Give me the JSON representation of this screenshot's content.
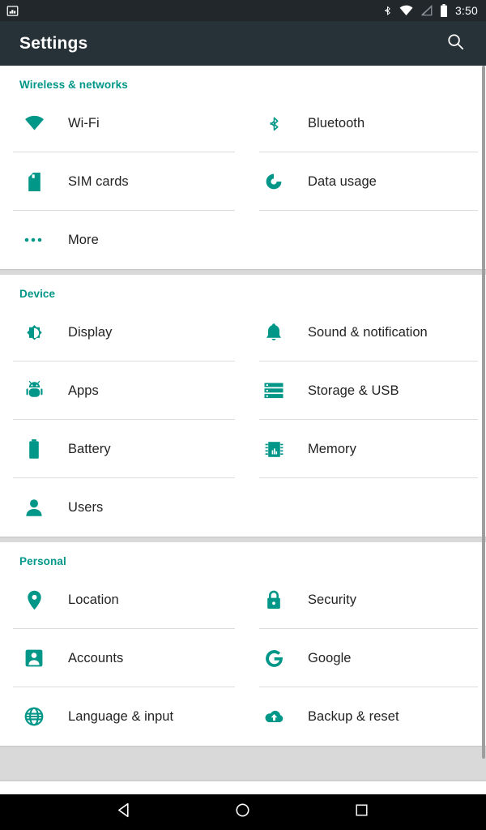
{
  "status_bar": {
    "notification_icon": "image-notification-icon",
    "icons": [
      "bluetooth-icon",
      "wifi-icon",
      "no-sim-signal-icon",
      "battery-icon"
    ],
    "clock": "3:50",
    "background_color": "#21272b"
  },
  "app_bar": {
    "title": "Settings",
    "search_icon": "search-icon",
    "background_color": "#263238"
  },
  "accent_color": "#009688",
  "sections": [
    {
      "title": "Wireless & networks",
      "items": [
        {
          "label": "Wi-Fi",
          "icon": "wifi-icon"
        },
        {
          "label": "Bluetooth",
          "icon": "bluetooth-icon"
        },
        {
          "label": "SIM cards",
          "icon": "sim-card-icon"
        },
        {
          "label": "Data usage",
          "icon": "data-usage-icon"
        },
        {
          "label": "More",
          "icon": "more-dots-icon"
        }
      ]
    },
    {
      "title": "Device",
      "items": [
        {
          "label": "Display",
          "icon": "brightness-icon"
        },
        {
          "label": "Sound & notification",
          "icon": "bell-icon"
        },
        {
          "label": "Apps",
          "icon": "android-robot-icon"
        },
        {
          "label": "Storage & USB",
          "icon": "storage-icon"
        },
        {
          "label": "Battery",
          "icon": "battery-icon"
        },
        {
          "label": "Memory",
          "icon": "memory-chip-icon"
        },
        {
          "label": "Users",
          "icon": "person-icon"
        }
      ]
    },
    {
      "title": "Personal",
      "items": [
        {
          "label": "Location",
          "icon": "location-pin-icon"
        },
        {
          "label": "Security",
          "icon": "lock-icon"
        },
        {
          "label": "Accounts",
          "icon": "account-box-icon"
        },
        {
          "label": "Google",
          "icon": "google-g-icon"
        },
        {
          "label": "Language & input",
          "icon": "globe-icon"
        },
        {
          "label": "Backup & reset",
          "icon": "cloud-upload-icon"
        }
      ]
    }
  ],
  "nav_bar": {
    "back_label": "back-button",
    "home_label": "home-button",
    "recents_label": "recents-button"
  }
}
